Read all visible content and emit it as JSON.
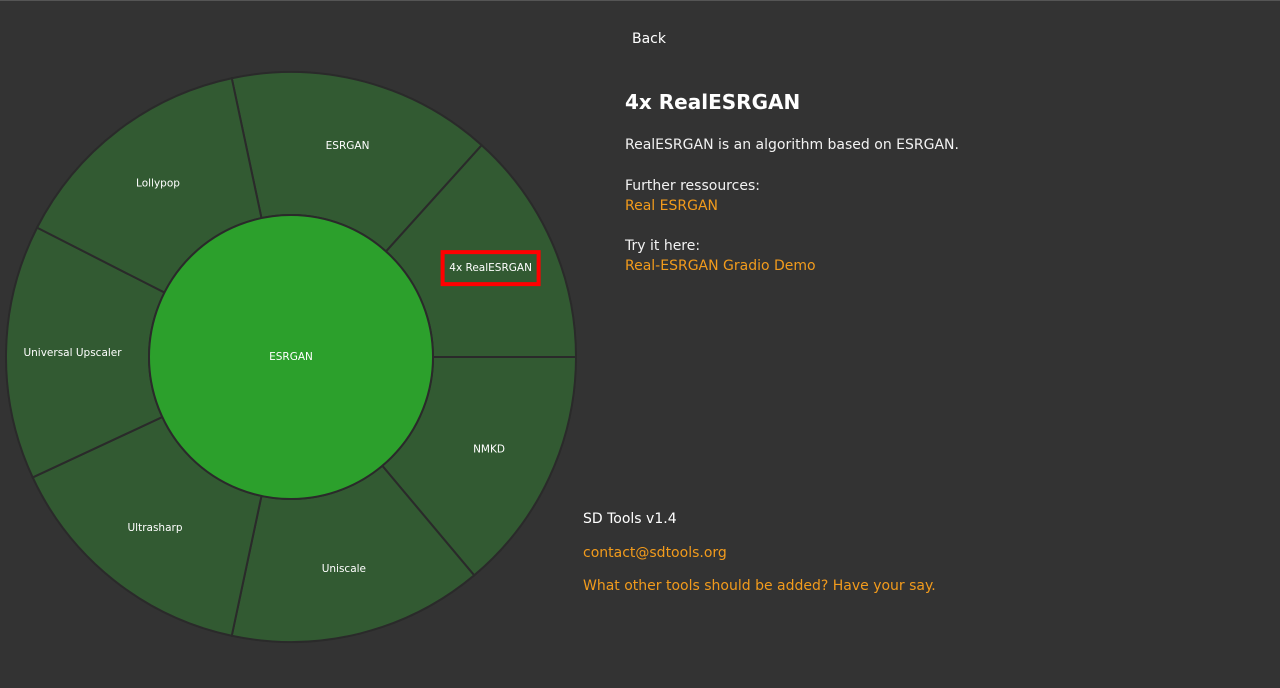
{
  "nav": {
    "back_label": "Back"
  },
  "sunburst": {
    "center_label": "ESRGAN",
    "colors": {
      "background": "#333333",
      "center": "#2ca02c",
      "ring": "#325a32",
      "stroke": "#2a2a2a",
      "highlight": "#ff0000"
    },
    "segments": [
      {
        "label": "ESRGAN"
      },
      {
        "label": "4x RealESRGAN",
        "highlighted": true
      },
      {
        "label": "NMKD"
      },
      {
        "label": "Uniscale"
      },
      {
        "label": "Ultrasharp"
      },
      {
        "label": "Universal Upscaler"
      },
      {
        "label": "Lollypop"
      }
    ]
  },
  "detail": {
    "title": "4x RealESRGAN",
    "description": "RealESRGAN is an algorithm based on ESRGAN.",
    "resources_label": "Further ressources:",
    "resources_link": "Real ESRGAN",
    "try_label": "Try it here:",
    "try_link": "Real-ESRGAN Gradio Demo"
  },
  "footer": {
    "version": "SD Tools v1.4",
    "contact": "contact@sdtools.org",
    "feedback": "What other tools should be added? Have your say."
  }
}
